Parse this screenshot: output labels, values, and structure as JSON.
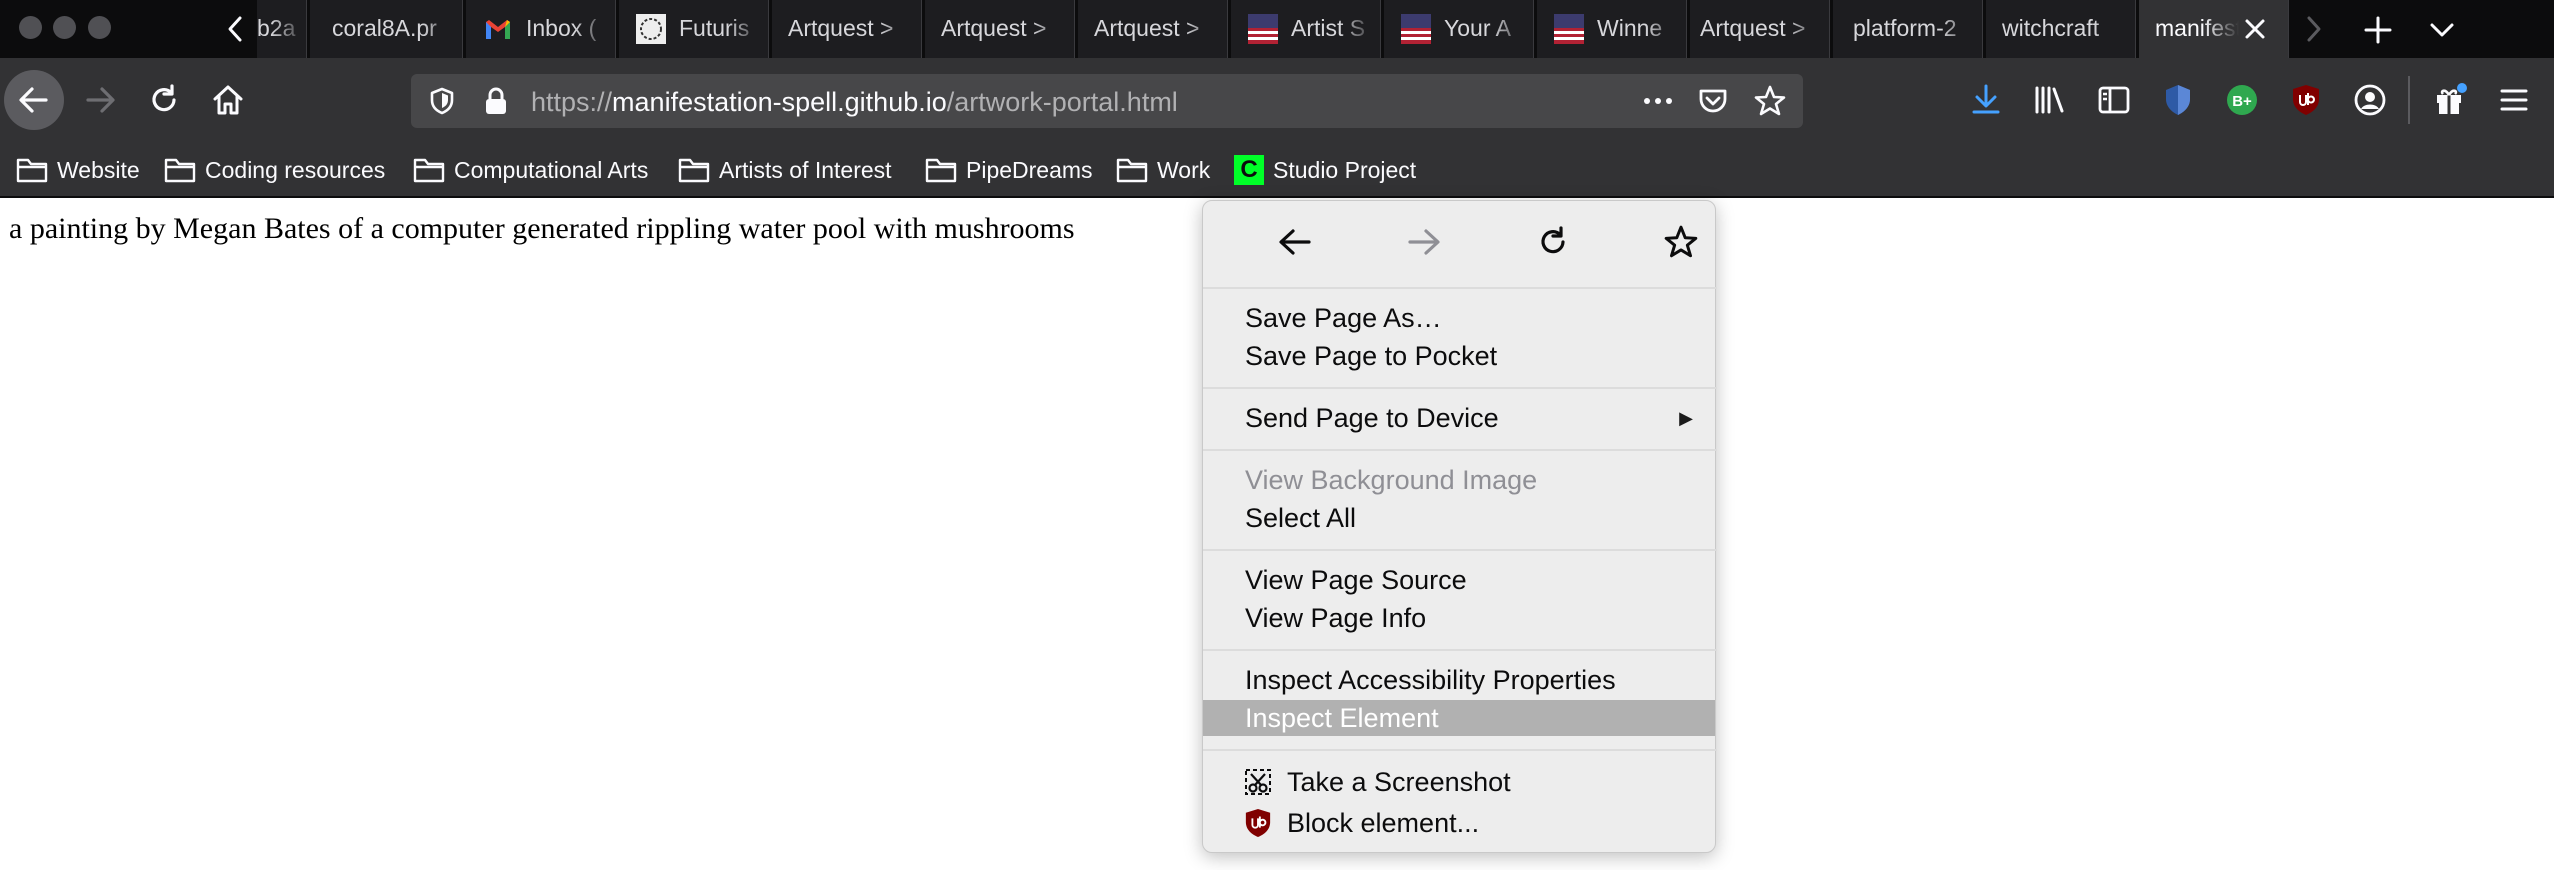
{
  "tabs": [
    {
      "label": "b2a"
    },
    {
      "label": "coral8A.pr"
    },
    {
      "label": "Inbox ("
    },
    {
      "label": "Futuris"
    },
    {
      "label": "Artquest >"
    },
    {
      "label": "Artquest >"
    },
    {
      "label": "Artquest >"
    },
    {
      "label": "Artist S"
    },
    {
      "label": "Your A"
    },
    {
      "label": "Winne"
    },
    {
      "label": "Artquest >"
    },
    {
      "label": "platform-2"
    },
    {
      "label": "witchcraft"
    },
    {
      "label": "manifest"
    }
  ],
  "url": {
    "domain_prefix": "https://",
    "domain": "manifestation-spell.github.io",
    "path": "/artwork-portal.html"
  },
  "bookmarks": [
    {
      "label": "Website",
      "icon": "folder-icon"
    },
    {
      "label": "Coding resources",
      "icon": "folder-icon"
    },
    {
      "label": "Computational Arts",
      "icon": "folder-icon"
    },
    {
      "label": "Artists of Interest",
      "icon": "folder-icon"
    },
    {
      "label": "PipeDreams",
      "icon": "folder-icon"
    },
    {
      "label": "Work",
      "icon": "folder-icon"
    },
    {
      "label": "Studio Project",
      "icon": "c-favicon",
      "favicon_letter": "C"
    }
  ],
  "extensions": {
    "bplus_badge": "B+"
  },
  "page": {
    "text": "a painting by Megan Bates of a computer generated rippling water pool with mushrooms"
  },
  "context_menu": {
    "groups": [
      [
        "Save Page As…",
        "Save Page to Pocket"
      ],
      [
        "Send Page to Device"
      ],
      [
        "View Background Image",
        "Select All"
      ],
      [
        "View Page Source",
        "View Page Info"
      ],
      [
        "Inspect Accessibility Properties",
        "Inspect Element"
      ],
      [
        "Take a Screenshot",
        "Block element..."
      ]
    ],
    "disabled_item": "View Background Image",
    "highlighted_item": "Inspect Element",
    "submenu_item": "Send Page to Device"
  },
  "colors": {
    "tabstrip_bg": "#0c0c0d",
    "toolbar_bg": "#323234",
    "urlbar_bg": "#474749",
    "menu_bg": "#ededed",
    "menu_highlight": "#b1b1b1",
    "accent_blue": "#45a1ff",
    "green_favicon": "#00ff28"
  }
}
